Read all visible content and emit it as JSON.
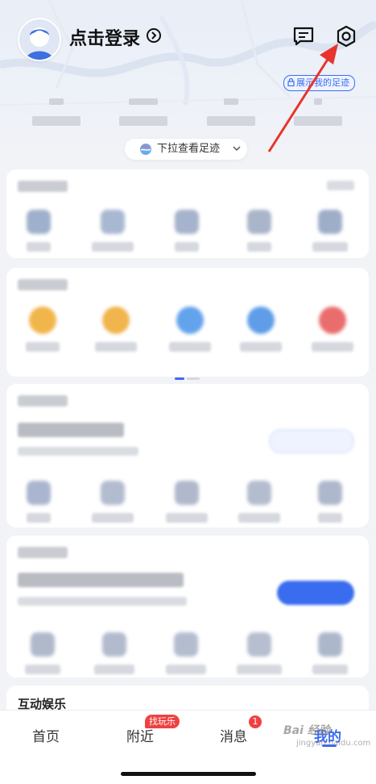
{
  "header": {
    "login_label": "点击登录",
    "footprint_badge": "展示我的足迹",
    "pull_label": "下拉查看足迹"
  },
  "icons": {
    "avatar": "avatar-icon",
    "login_chevron": "chevron-right-circle-icon",
    "messages": "message-icon",
    "settings": "gear-icon",
    "lock": "lock-icon",
    "globe": "globe-icon",
    "chevron_down": "chevron-down-icon"
  },
  "sections": {
    "entertainment_label": "互动娱乐"
  },
  "tabbar": {
    "tabs": [
      {
        "label": "首页",
        "active": false
      },
      {
        "label": "附近",
        "active": false
      },
      {
        "label": "消息",
        "active": false
      },
      {
        "label": "我的",
        "active": true
      }
    ],
    "nearby_badge": "找玩乐",
    "messages_count": "1"
  },
  "watermark": {
    "text": "Bai 经验",
    "sub": "jingyan.baidu.com"
  },
  "colors": {
    "accent": "#3a6cf0",
    "badge_red": "#f04141",
    "annotation_arrow": "#e8342c"
  }
}
